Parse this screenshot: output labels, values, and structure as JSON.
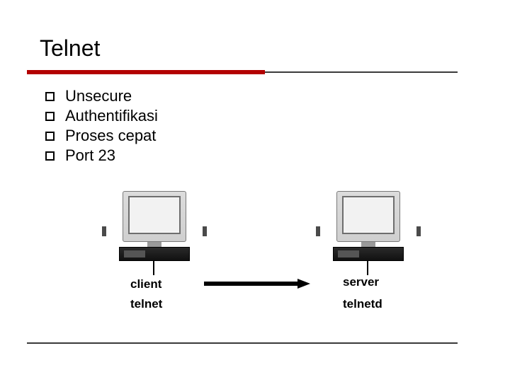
{
  "title": "Telnet",
  "bullets": [
    "Unsecure",
    "Authentifikasi",
    "Proses cepat",
    "Port 23"
  ],
  "labels": {
    "client_top": "client",
    "client_bottom": "telnet",
    "server_top": "server",
    "server_bottom": "telnetd"
  }
}
